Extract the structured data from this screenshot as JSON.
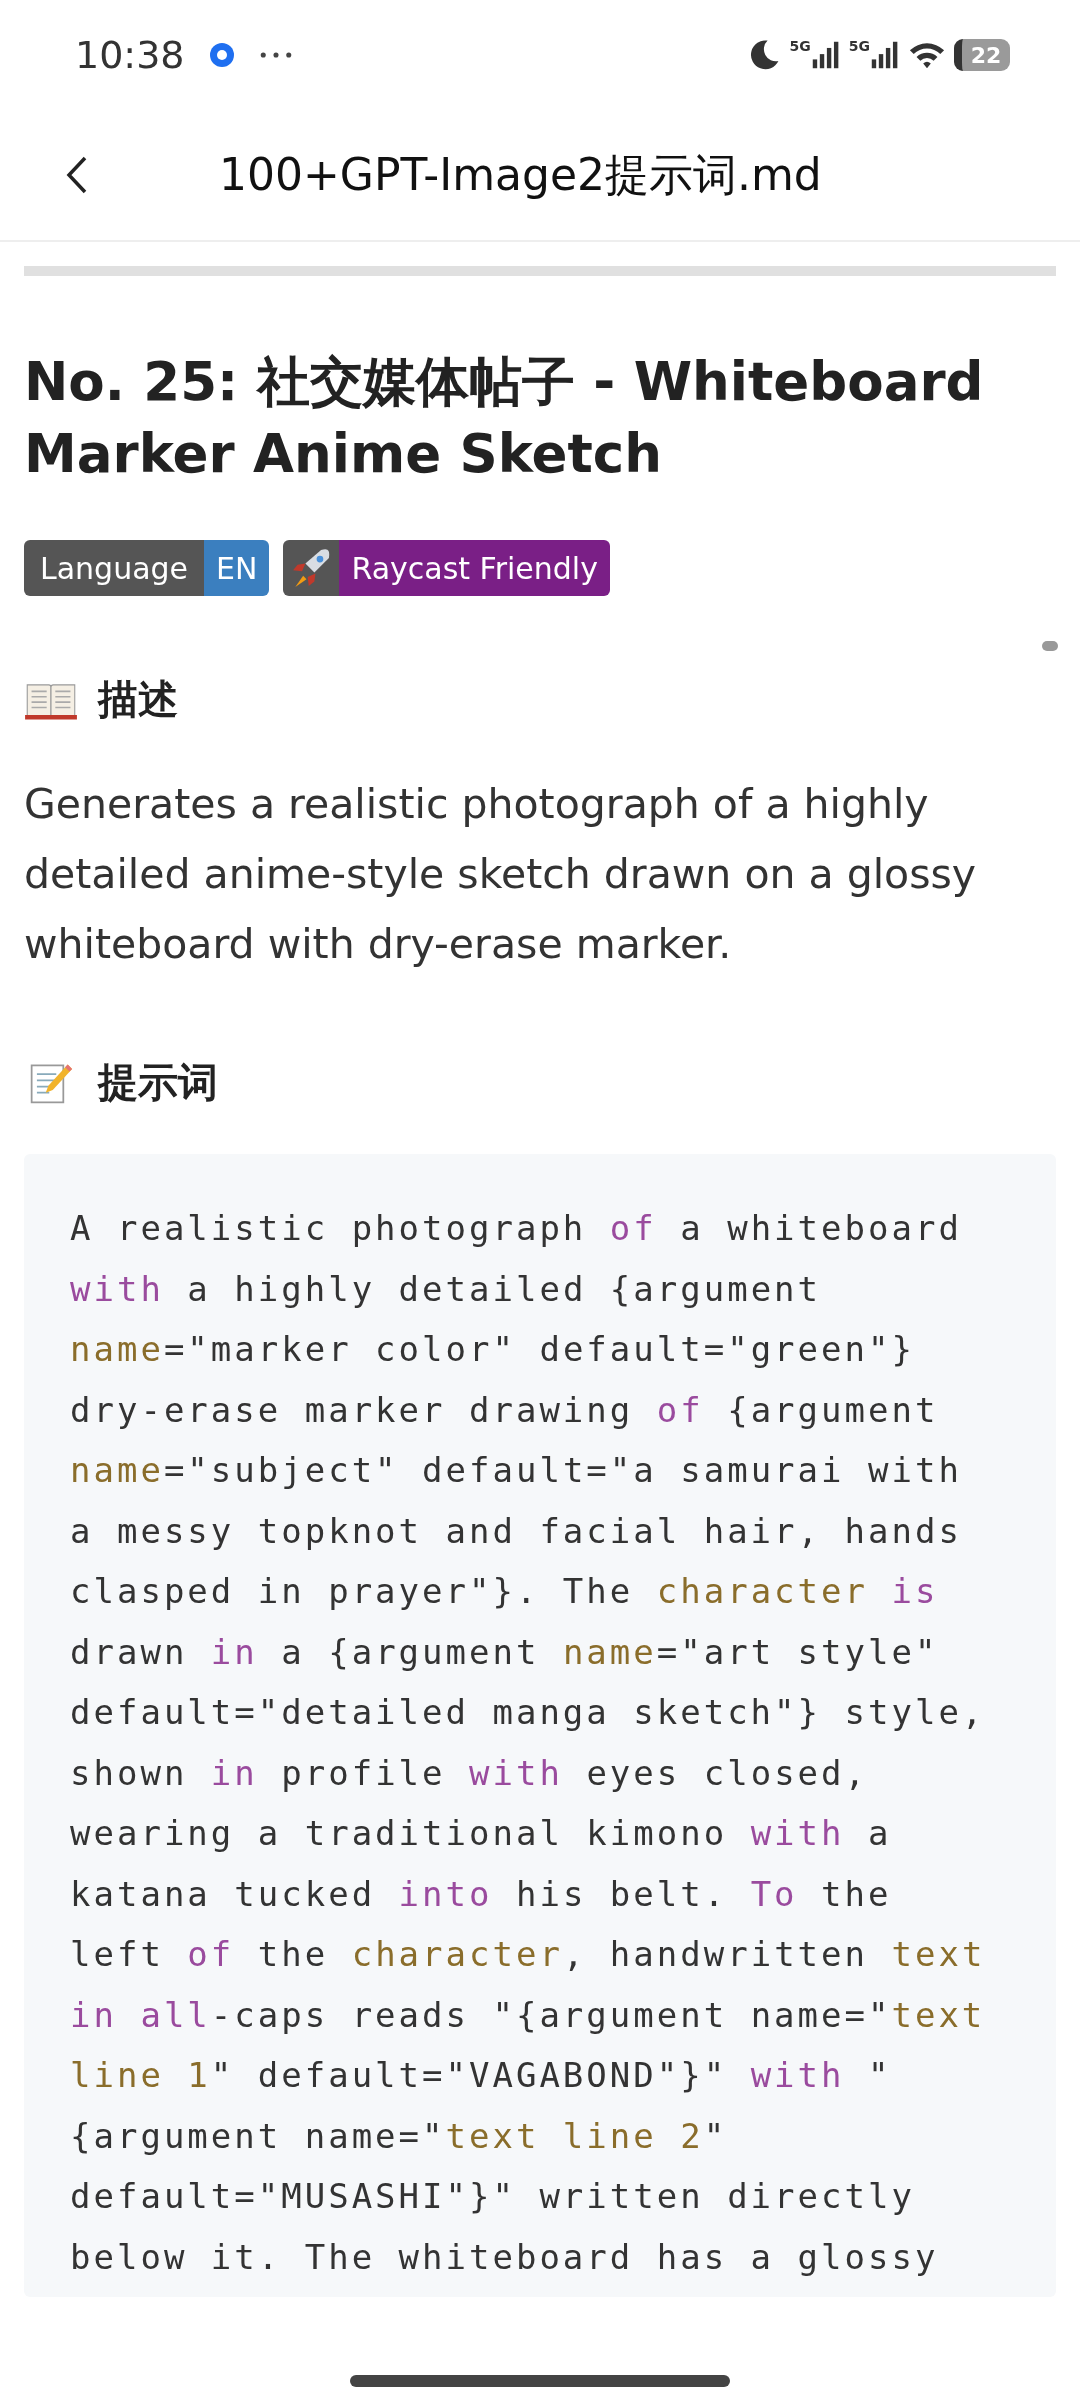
{
  "status_bar": {
    "time": "10:38",
    "networks": [
      "5G",
      "5G"
    ],
    "battery": "22"
  },
  "header": {
    "title": "100+GPT-Image2提示词.md"
  },
  "heading": "No. 25: 社交媒体帖子 - Whiteboard Marker Anime Sketch",
  "badges": [
    {
      "kind": "text",
      "label": "Language",
      "message": "EN",
      "color": "#3b7fbf"
    },
    {
      "kind": "rocket",
      "message": "Raycast Friendly",
      "color": "#7a1f86"
    }
  ],
  "sections": [
    {
      "kind": "book",
      "title": "描述",
      "text": "Generates a realistic photograph of a highly detailed anime-style sketch drawn on a glossy whiteboard with dry-erase marker."
    },
    {
      "kind": "memo",
      "title": "提示词",
      "code": [
        [
          {
            "kind": "plain",
            "text": "A realistic photograph "
          },
          {
            "kind": "keyword",
            "text": "of"
          },
          {
            "kind": "plain",
            "text": " a whiteboard"
          }
        ],
        [
          {
            "kind": "keyword",
            "text": "with"
          },
          {
            "kind": "plain",
            "text": " a highly detailed {argument"
          }
        ],
        [
          {
            "kind": "name",
            "text": "name"
          },
          {
            "kind": "plain",
            "text": "=\"marker color\" default=\"green\"}"
          }
        ],
        [
          {
            "kind": "plain",
            "text": "dry-erase marker drawing "
          },
          {
            "kind": "keyword",
            "text": "of"
          },
          {
            "kind": "plain",
            "text": " {argument"
          }
        ],
        [
          {
            "kind": "name",
            "text": "name"
          },
          {
            "kind": "plain",
            "text": "=\"subject\" default=\"a samurai with"
          }
        ],
        [
          {
            "kind": "plain",
            "text": "a messy topknot and facial hair, hands"
          }
        ],
        [
          {
            "kind": "plain",
            "text": "clasped in prayer\"}. The "
          },
          {
            "kind": "name",
            "text": "character"
          },
          {
            "kind": "keyword",
            "text": " is"
          }
        ],
        [
          {
            "kind": "plain",
            "text": "drawn "
          },
          {
            "kind": "keyword",
            "text": "in"
          },
          {
            "kind": "plain",
            "text": " a {argument "
          },
          {
            "kind": "name",
            "text": "name"
          },
          {
            "kind": "plain",
            "text": "=\"art style\""
          }
        ],
        [
          {
            "kind": "plain",
            "text": "default=\"detailed manga sketch\"} style,"
          }
        ],
        [
          {
            "kind": "plain",
            "text": "shown "
          },
          {
            "kind": "keyword",
            "text": "in"
          },
          {
            "kind": "plain",
            "text": " profile "
          },
          {
            "kind": "keyword",
            "text": "with"
          },
          {
            "kind": "plain",
            "text": " eyes closed,"
          }
        ],
        [
          {
            "kind": "plain",
            "text": "wearing a traditional kimono "
          },
          {
            "kind": "keyword",
            "text": "with"
          },
          {
            "kind": "plain",
            "text": " a"
          }
        ],
        [
          {
            "kind": "plain",
            "text": "katana tucked "
          },
          {
            "kind": "keyword",
            "text": "into"
          },
          {
            "kind": "plain",
            "text": " his belt. "
          },
          {
            "kind": "keyword",
            "text": "To"
          },
          {
            "kind": "plain",
            "text": " the"
          }
        ],
        [
          {
            "kind": "plain",
            "text": "left "
          },
          {
            "kind": "keyword",
            "text": "of"
          },
          {
            "kind": "plain",
            "text": " the "
          },
          {
            "kind": "name",
            "text": "character"
          },
          {
            "kind": "plain",
            "text": ", handwritten "
          },
          {
            "kind": "name",
            "text": "text"
          }
        ],
        [
          {
            "kind": "keyword",
            "text": "in all"
          },
          {
            "kind": "plain",
            "text": "-caps reads \"{argument name=\""
          },
          {
            "kind": "name",
            "text": "text"
          }
        ],
        [
          {
            "kind": "name",
            "text": "line 1"
          },
          {
            "kind": "plain",
            "text": "\" default=\"VAGABOND\"}\" "
          },
          {
            "kind": "keyword",
            "text": "with"
          },
          {
            "kind": "plain",
            "text": " \""
          }
        ],
        [
          {
            "kind": "plain",
            "text": "{argument name=\""
          },
          {
            "kind": "name",
            "text": "text line 2"
          },
          {
            "kind": "plain",
            "text": "\""
          }
        ],
        [
          {
            "kind": "plain",
            "text": "default=\"MUSASHI\"}\" written directly"
          }
        ],
        [
          {
            "kind": "plain",
            "text": "below it. The whiteboard has a glossy"
          }
        ]
      ]
    }
  ]
}
